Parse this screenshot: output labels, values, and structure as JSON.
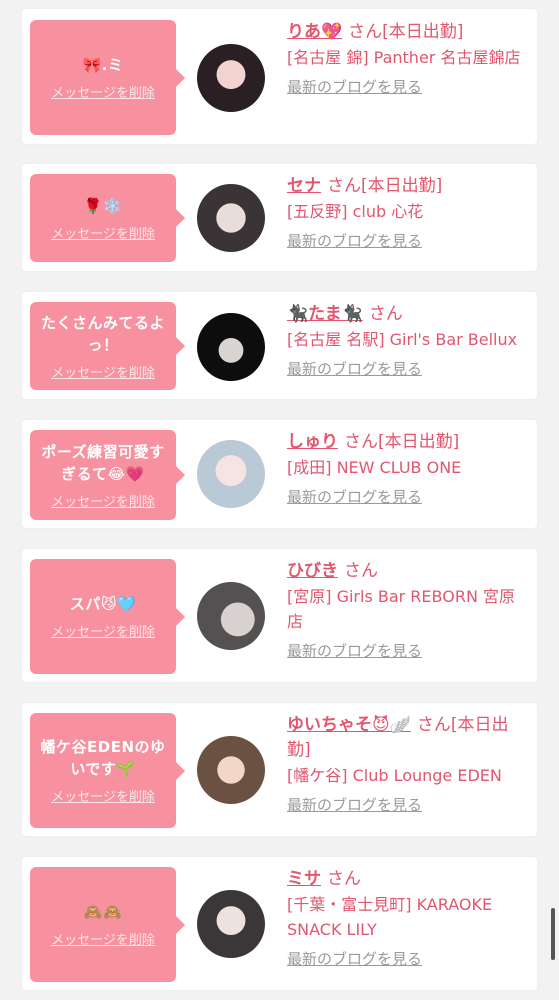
{
  "delete_label": "メッセージを削除",
  "blog_label": "最新のブログを見る",
  "san_label": "さん",
  "entries": [
    {
      "message": "🎀.ミ",
      "name": "りあ💖",
      "suffix": "[本日出勤]",
      "shop": "[名古屋 錦] Panther 名古屋錦店"
    },
    {
      "message": "🌹❄️",
      "name": "セナ",
      "suffix": "[本日出勤]",
      "shop": "[五反野] club 心花"
    },
    {
      "message": "たくさんみてるよっ！",
      "name": "🐈‍⬛たま🐈‍⬛",
      "suffix": "",
      "shop": "[名古屋 名駅] Girl's Bar Bellux"
    },
    {
      "message": "ポーズ練習可愛すぎるて😂💗",
      "name": "しゅり",
      "suffix": "[本日出勤]",
      "shop": "[成田] NEW CLUB ONE"
    },
    {
      "message": "スパ😼🩵",
      "name": "ひびき",
      "suffix": "",
      "shop": "[宮原] Girls Bar REBORN 宮原店"
    },
    {
      "message": "幡ケ谷EDENのゆいです🌱",
      "name": "ゆいちゃそ😈🪽",
      "suffix": "[本日出勤]",
      "shop": "[幡ケ谷] Club Lounge EDEN"
    },
    {
      "message": "🙈🙈",
      "name": "ミサ",
      "suffix": "",
      "shop": "[千葉・富士見町] KARAOKE SNACK LILY"
    }
  ]
}
